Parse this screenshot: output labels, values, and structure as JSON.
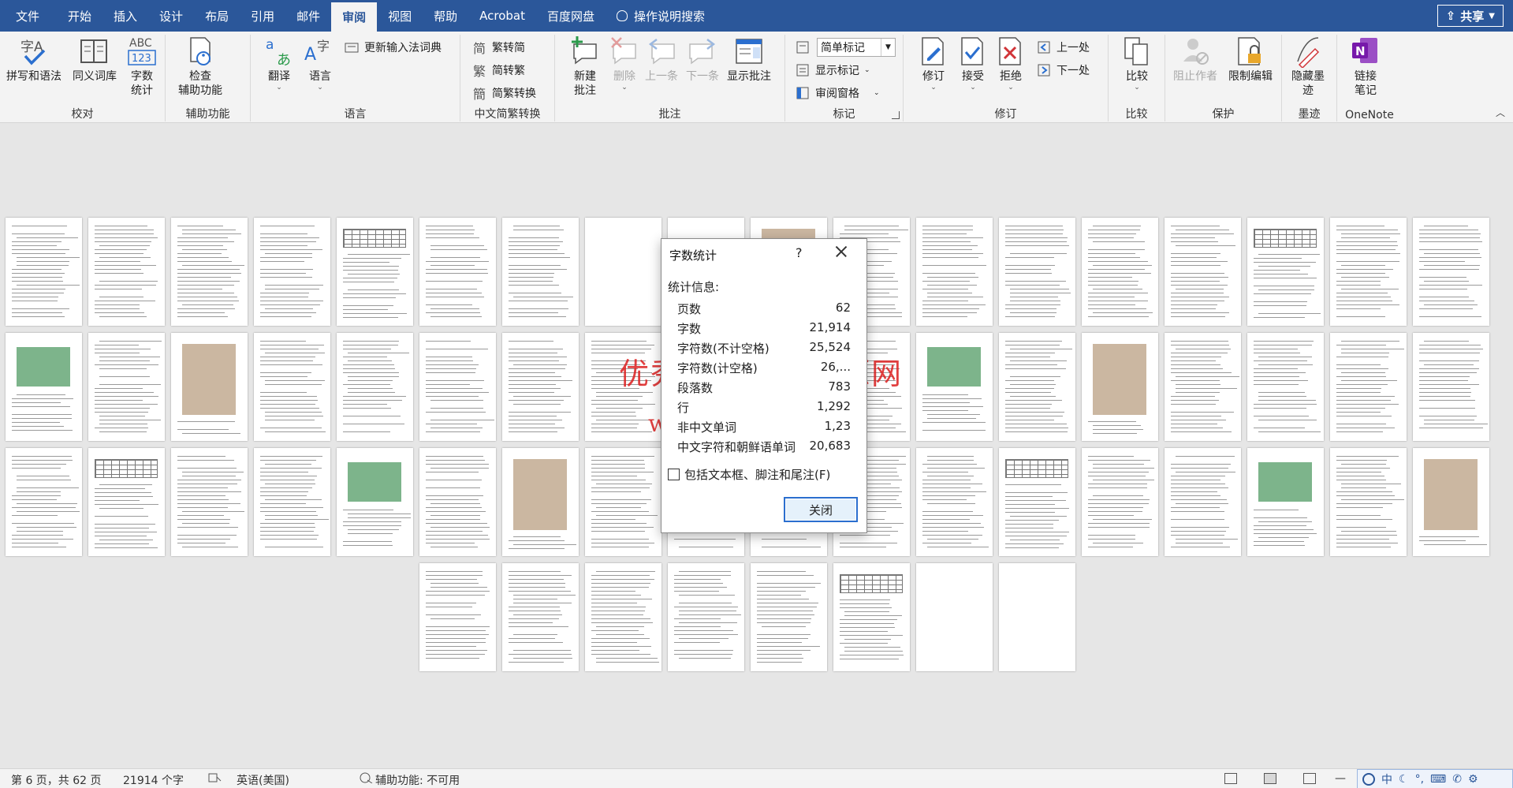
{
  "menu": {
    "tabs": [
      "文件",
      "开始",
      "插入",
      "设计",
      "布局",
      "引用",
      "邮件",
      "审阅",
      "视图",
      "帮助",
      "Acrobat",
      "百度网盘"
    ],
    "active_tab": "审阅",
    "search": "操作说明搜索",
    "share": "共享"
  },
  "ribbon": {
    "proofing": {
      "label": "校对",
      "spelling": "拼写和语法",
      "thesaurus": "同义词库",
      "wordcount_l1": "字数",
      "wordcount_l2": "统计"
    },
    "accessibility": {
      "label": "辅助功能",
      "check_l1": "检查",
      "check_l2": "辅助功能"
    },
    "language": {
      "label": "语言",
      "translate": "翻译",
      "language": "语言",
      "update_ime": "更新输入法词典"
    },
    "chinese": {
      "label": "中文简繁转换",
      "to_simplified": "繁转简",
      "to_traditional": "简转繁",
      "convert": "简繁转换"
    },
    "comments": {
      "label": "批注",
      "new_l1": "新建",
      "new_l2": "批注",
      "delete": "删除",
      "previous": "上一条",
      "next": "下一条",
      "show": "显示批注"
    },
    "tracking": {
      "label": "标记",
      "markup_value": "简单标记",
      "show_markup": "显示标记",
      "reviewing_pane": "审阅窗格"
    },
    "changes": {
      "label": "修订",
      "track": "修订",
      "accept": "接受",
      "reject": "拒绝",
      "prev": "上一处",
      "next": "下一处"
    },
    "compare": {
      "label": "比较",
      "compare": "比较"
    },
    "protect": {
      "label": "保护",
      "block_authors": "阻止作者",
      "restrict": "限制编辑"
    },
    "ink": {
      "label": "墨迹",
      "hide_l1": "隐藏墨",
      "hide_l2": "迹"
    },
    "onenote": {
      "label": "OneNote",
      "linked_l1": "链接",
      "linked_l2": "笔记"
    }
  },
  "dialog": {
    "title": "字数统计",
    "help": "?",
    "stats_label": "统计信息:",
    "stats": [
      {
        "label": "页数",
        "value": "62"
      },
      {
        "label": "字数",
        "value": "21,914"
      },
      {
        "label": "字符数(不计空格)",
        "value": "25,524"
      },
      {
        "label": "字符数(计空格)",
        "value": "26,..."
      },
      {
        "label": "段落数",
        "value": "783"
      },
      {
        "label": "行",
        "value": "1,292"
      },
      {
        "label": "非中文单词",
        "value": "1,23"
      },
      {
        "label": "中文字符和朝鲜语单词",
        "value": "20,683"
      }
    ],
    "include_textboxes": "包括文本框、脚注和尾注(F)",
    "close": "关闭"
  },
  "watermark": {
    "line1": "优秀毕业设计资源网",
    "line2": "www.keyicad.cn"
  },
  "status": {
    "page": "第 6 页，共 62 页",
    "words": "21914 个字",
    "language": "英语(美国)",
    "accessibility": "辅助功能: 不可用",
    "ime_mode": "中"
  },
  "colors": {
    "brand": "#2b579a",
    "watermark": "#dc1e1e"
  }
}
